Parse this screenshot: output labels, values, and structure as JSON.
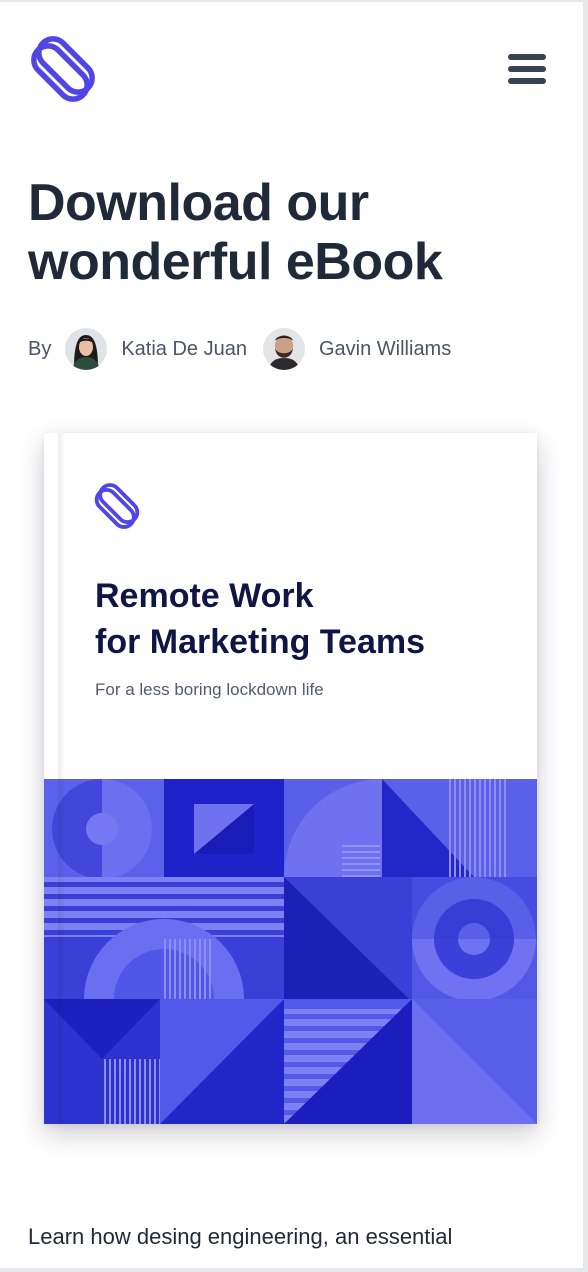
{
  "header": {
    "logo_icon": "interlocked-loops-logo-icon",
    "menu_icon": "hamburger-menu-icon"
  },
  "hero": {
    "title_line1": "Download our",
    "title_line2": "wonderful eBook",
    "by_label": "By",
    "authors": [
      {
        "name": "Katia De Juan",
        "avatar": "woman-avatar"
      },
      {
        "name": "Gavin Williams",
        "avatar": "bearded-man-avatar"
      }
    ]
  },
  "book": {
    "title_line1": "Remote Work",
    "title_line2": "for Marketing Teams",
    "subtitle": "For a less boring lockdown life",
    "art": "geometric-pattern-cover-art"
  },
  "body": {
    "intro": "Learn how desing engineering, an essential"
  },
  "colors": {
    "brand": "#4f46e5",
    "heading": "#1f2937",
    "book_title": "#0f1646",
    "pattern_base": "#5258e8",
    "pattern_dark": "#1d1cc9",
    "pattern_light": "#7175f2"
  }
}
